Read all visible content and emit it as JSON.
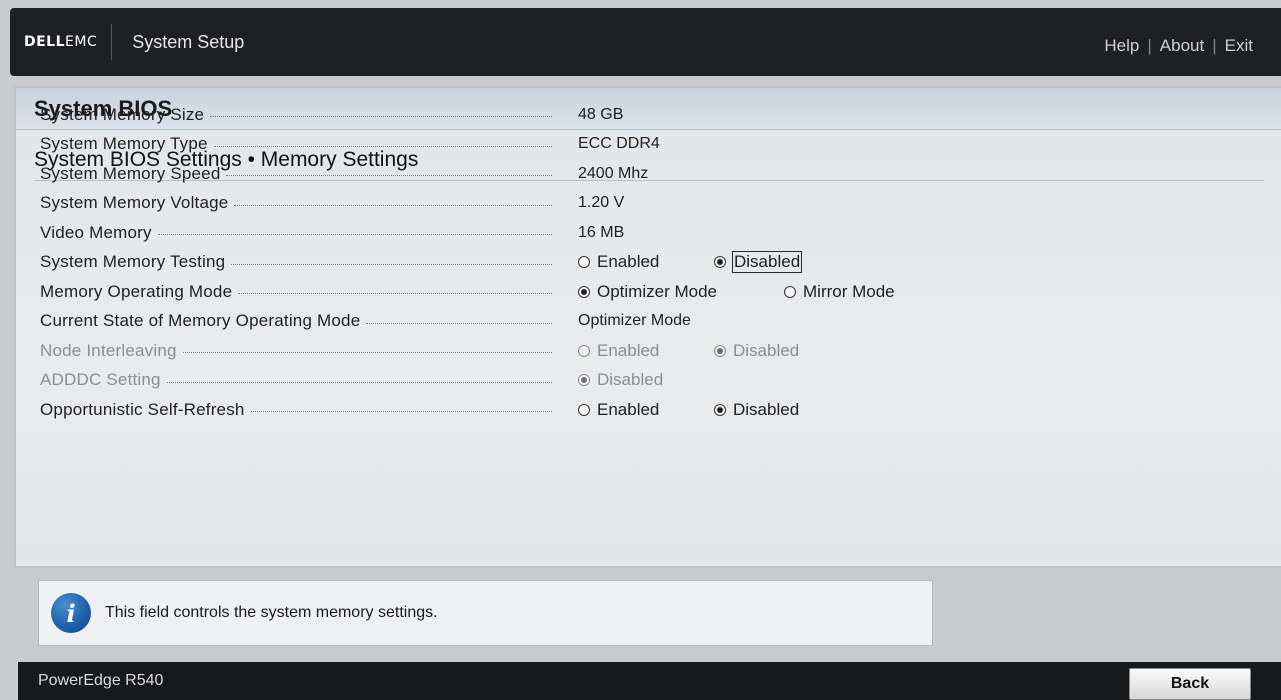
{
  "header": {
    "logo_dell": "DELL",
    "logo_emc": "EMC",
    "app_title": "System Setup",
    "links": {
      "help": "Help",
      "about": "About",
      "exit": "Exit"
    },
    "link_separator": "|"
  },
  "panel": {
    "title": "System BIOS",
    "section_title": "System BIOS Settings • Memory Settings"
  },
  "settings": {
    "memory_size": {
      "label": "System Memory Size",
      "value": "48 GB"
    },
    "memory_type": {
      "label": "System Memory Type",
      "value": "ECC DDR4"
    },
    "memory_speed": {
      "label": "System Memory Speed",
      "value": "2400 Mhz"
    },
    "memory_voltage": {
      "label": "System Memory Voltage",
      "value": "1.20 V"
    },
    "video_memory": {
      "label": "Video Memory",
      "value": "16 MB"
    },
    "memory_testing": {
      "label": "System Memory Testing",
      "options": [
        "Enabled",
        "Disabled"
      ],
      "selected": "Disabled"
    },
    "operating_mode": {
      "label": "Memory Operating Mode",
      "options": [
        "Optimizer Mode",
        "Mirror Mode"
      ],
      "selected": "Optimizer Mode"
    },
    "current_state": {
      "label": "Current State of Memory Operating Mode",
      "value": "Optimizer Mode"
    },
    "node_interleaving": {
      "label": "Node Interleaving",
      "options": [
        "Enabled",
        "Disabled"
      ],
      "selected": "Disabled",
      "disabled": true
    },
    "adddc": {
      "label": "ADDDC Setting",
      "options": [
        "Disabled"
      ],
      "selected": "Disabled",
      "disabled": true
    },
    "self_refresh": {
      "label": "Opportunistic Self-Refresh",
      "options": [
        "Enabled",
        "Disabled"
      ],
      "selected": "Disabled"
    }
  },
  "help": {
    "icon": "info-icon",
    "text": "This field controls the system memory settings."
  },
  "footer": {
    "model": "PowerEdge R540",
    "back_label": "Back"
  }
}
